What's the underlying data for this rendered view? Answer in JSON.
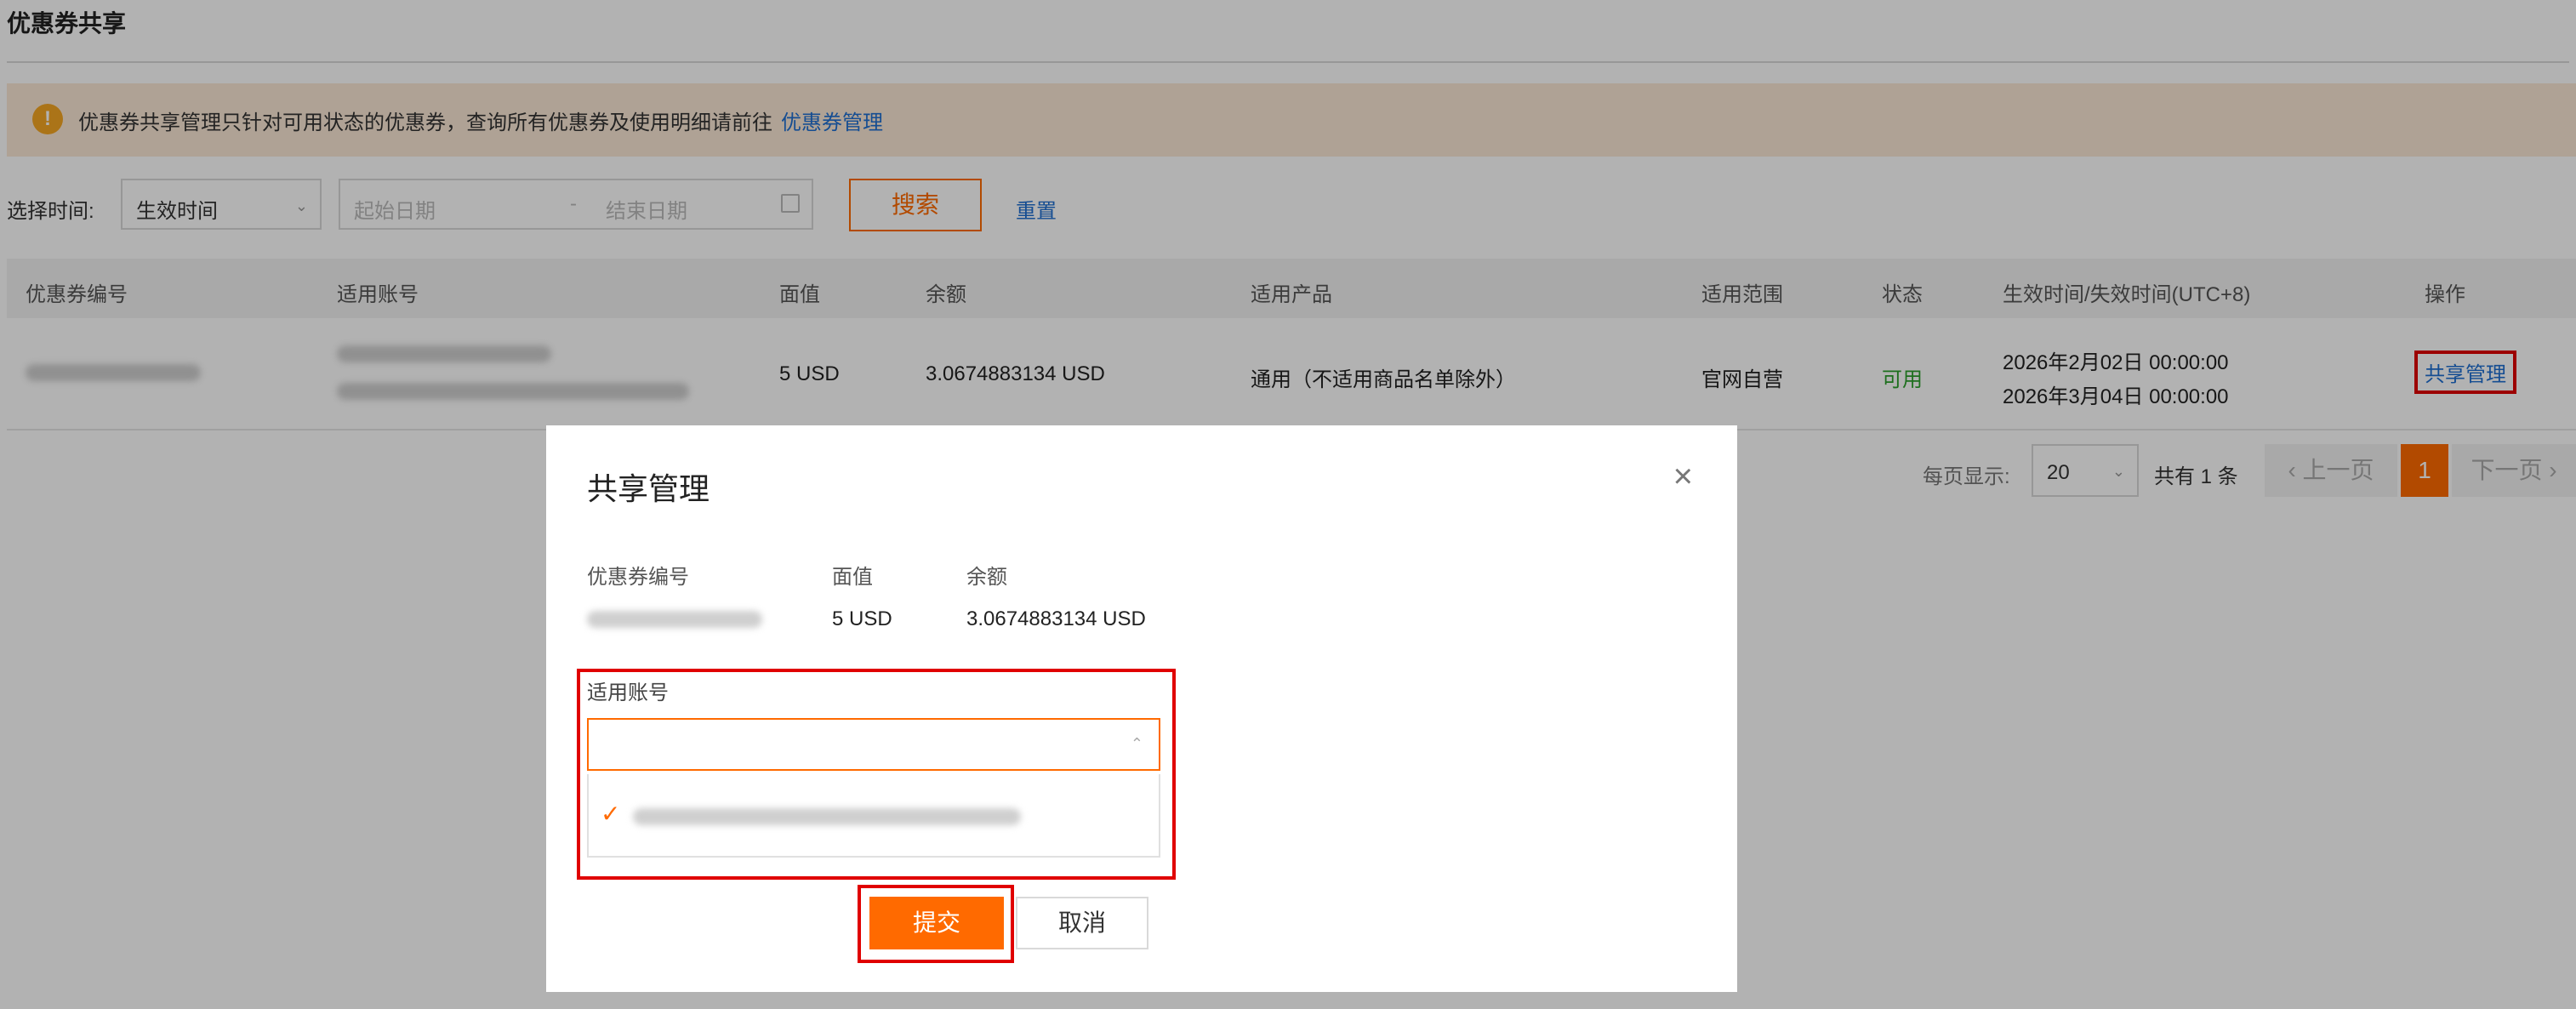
{
  "page": {
    "title": "优惠券共享"
  },
  "notice": {
    "text": "优惠券共享管理只针对可用状态的优惠券，查询所有优惠券及使用明细请前往",
    "link": "优惠券管理",
    "icon": "info-icon"
  },
  "filter": {
    "label": "选择时间:",
    "type_value": "生效时间",
    "start_placeholder": "起始日期",
    "separator": "-",
    "end_placeholder": "结束日期",
    "search_label": "搜索",
    "reset_label": "重置"
  },
  "table": {
    "headers": [
      "优惠券编号",
      "适用账号",
      "面值",
      "余额",
      "适用产品",
      "适用范围",
      "状态",
      "生效时间/失效时间(UTC+8)",
      "操作"
    ],
    "rows": [
      {
        "face_value": "5 USD",
        "balance": "3.0674883134 USD",
        "product": "通用（不适用商品名单除外）",
        "scope": "官网自营",
        "status": "可用",
        "start_time": "2026年2月02日 00:00:00",
        "end_time": "2026年3月04日 00:00:00",
        "action": "共享管理"
      }
    ]
  },
  "pager": {
    "page_size_label": "每页显示:",
    "page_size": "20",
    "total": "共有 1 条",
    "prev": "上一页",
    "current": "1",
    "next": "下一页"
  },
  "modal": {
    "title": "共享管理",
    "col_id": "优惠券编号",
    "col_face": "面值",
    "col_balance": "余额",
    "face_value": "5 USD",
    "balance": "3.0674883134 USD",
    "accounts_label": "适用账号",
    "submit": "提交",
    "cancel": "取消",
    "close_icon": "close-icon"
  },
  "colors": {
    "accent": "#ff6a00",
    "link": "#1f6fd1",
    "highlight": "#e00000",
    "status_ok": "#2ca02c"
  }
}
